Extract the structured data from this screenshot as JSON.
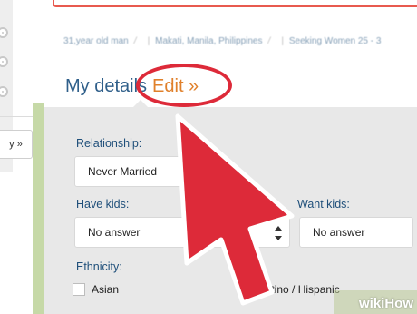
{
  "breadcrumb": {
    "items": [
      "31,year old man",
      "Makati, Manila, Philippines",
      "Seeking Women 25 - 3"
    ]
  },
  "left_panel": {
    "button_label": "y »"
  },
  "details": {
    "heading": "My details",
    "edit_label": "Edit »"
  },
  "relationship": {
    "label": "Relationship:",
    "value": "Never Married"
  },
  "have_kids": {
    "label": "Have kids:",
    "value": "No answer"
  },
  "want_kids": {
    "label": "Want kids:",
    "value": "No answer"
  },
  "ethnicity": {
    "label": "Ethnicity:",
    "options": [
      "Asian",
      "Latino / Hispanic"
    ]
  },
  "watermark": "wikiHow",
  "colors": {
    "heading": "#2f5f8a",
    "edit_link": "#e0802b",
    "highlight": "#dd2a39",
    "panel": "#e8e8e8"
  }
}
